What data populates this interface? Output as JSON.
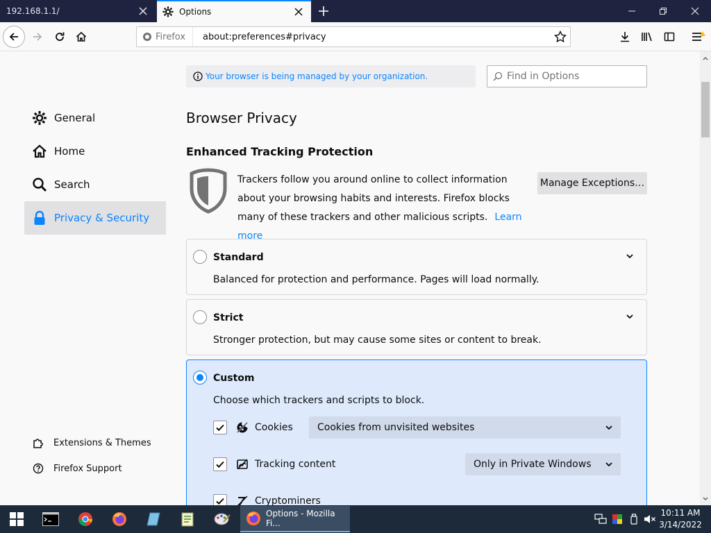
{
  "browser": {
    "tabs": [
      {
        "label": "192.168.1.1/",
        "active": false
      },
      {
        "label": "Options",
        "active": true
      }
    ],
    "identity_label": "Firefox",
    "url": "about:preferences#privacy"
  },
  "sidebar": {
    "categories": [
      {
        "label": "General",
        "icon": "gear-icon"
      },
      {
        "label": "Home",
        "icon": "home-icon"
      },
      {
        "label": "Search",
        "icon": "search-icon"
      },
      {
        "label": "Privacy & Security",
        "icon": "lock-icon",
        "selected": true
      }
    ],
    "footer": [
      {
        "label": "Extensions & Themes",
        "icon": "puzzle-icon"
      },
      {
        "label": "Firefox Support",
        "icon": "help-icon"
      }
    ]
  },
  "content": {
    "policies_notice": "Your browser is being managed by your organization.",
    "search_placeholder": "Find in Options",
    "page_title": "Browser Privacy",
    "etp_heading": "Enhanced Tracking Protection",
    "etp_description": "Trackers follow you around online to collect information about your browsing habits and interests. Firefox blocks many of these trackers and other malicious scripts.",
    "learn_more": "Learn more",
    "manage_exceptions": "Manage Exceptions…",
    "modes": [
      {
        "title": "Standard",
        "description": "Balanced for protection and performance. Pages will load normally.",
        "selected": false
      },
      {
        "title": "Strict",
        "description": "Stronger protection, but may cause some sites or content to break.",
        "selected": false
      },
      {
        "title": "Custom",
        "description": "Choose which trackers and scripts to block.",
        "selected": true
      }
    ],
    "custom_options": [
      {
        "label": "Cookies",
        "checked": true,
        "icon": "cookie-icon",
        "dropdown": "Cookies from unvisited websites"
      },
      {
        "label": "Tracking content",
        "checked": true,
        "icon": "tracking-content-icon",
        "dropdown": "Only in Private Windows"
      },
      {
        "label": "Cryptominers",
        "checked": true,
        "icon": "cryptominer-icon"
      }
    ]
  },
  "taskbar": {
    "window_label": "Options - Mozilla Fi...",
    "time": "10:11 AM",
    "date": "3/14/2022"
  },
  "colors": {
    "accent": "#0a84ff",
    "tab_bar": "#202340",
    "taskbar": "#1c2a3a",
    "selected_panel": "#deeafc"
  }
}
